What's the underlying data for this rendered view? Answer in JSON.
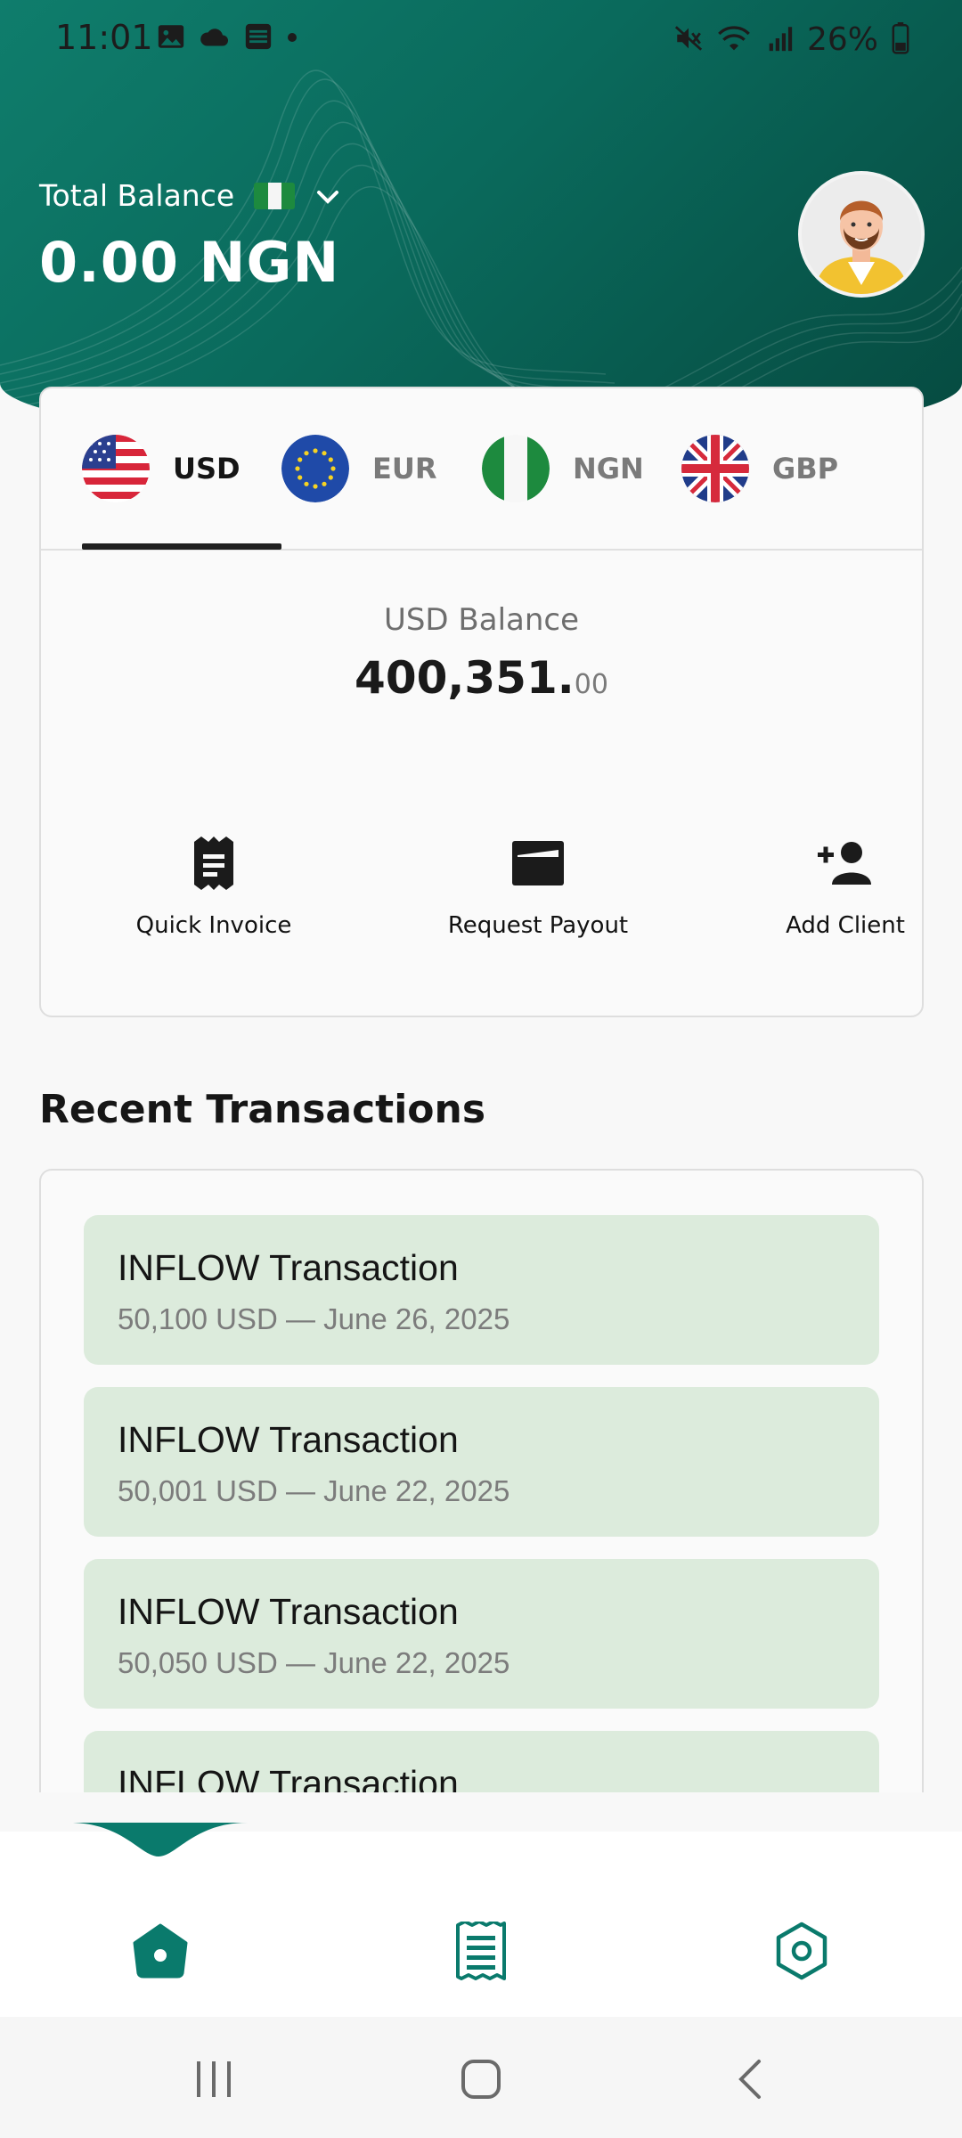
{
  "status_bar": {
    "time": "11:01",
    "battery": "26%",
    "icons": [
      "gallery-icon",
      "cloud-icon",
      "news-icon",
      "dot-icon",
      "mute-icon",
      "wifi-icon",
      "signal-icon",
      "battery-icon"
    ]
  },
  "header": {
    "total_balance_label": "Total Balance",
    "total_balance_value": "0.00 NGN",
    "currency_flag": "Nigeria",
    "colors": {
      "gradient_start": "#0f7d6c",
      "gradient_end": "#064a40"
    }
  },
  "currency_tabs": [
    {
      "code": "USD",
      "flag": "us-flag-icon",
      "active": true
    },
    {
      "code": "EUR",
      "flag": "eu-flag-icon",
      "active": false
    },
    {
      "code": "NGN",
      "flag": "ng-flag-icon",
      "active": false
    },
    {
      "code": "GBP",
      "flag": "gb-flag-icon",
      "active": false
    }
  ],
  "balance": {
    "label": "USD Balance",
    "whole": "400,351.",
    "cents": "00"
  },
  "actions": [
    {
      "label": "Quick Invoice",
      "icon": "invoice-icon"
    },
    {
      "label": "Request Payout",
      "icon": "payout-icon"
    },
    {
      "label": "Add Client",
      "icon": "add-person-icon"
    }
  ],
  "recent_transactions": {
    "title": "Recent Transactions",
    "items": [
      {
        "title": "INFLOW Transaction",
        "detail": "50,100 USD — June 26, 2025"
      },
      {
        "title": "INFLOW Transaction",
        "detail": "50,001 USD — June 22, 2025"
      },
      {
        "title": "INFLOW Transaction",
        "detail": "50,050 USD — June 22, 2025"
      },
      {
        "title": "INFLOW Transaction",
        "detail": ""
      }
    ],
    "item_color": "#dcebdc"
  },
  "bottom_nav": {
    "items": [
      {
        "name": "home",
        "icon": "home-icon",
        "active": true
      },
      {
        "name": "transactions",
        "icon": "receipt-icon",
        "active": false
      },
      {
        "name": "settings",
        "icon": "settings-icon",
        "active": false
      }
    ],
    "accent": "#0a7a6c"
  },
  "system_nav": [
    "recents-button",
    "home-button",
    "back-button"
  ]
}
